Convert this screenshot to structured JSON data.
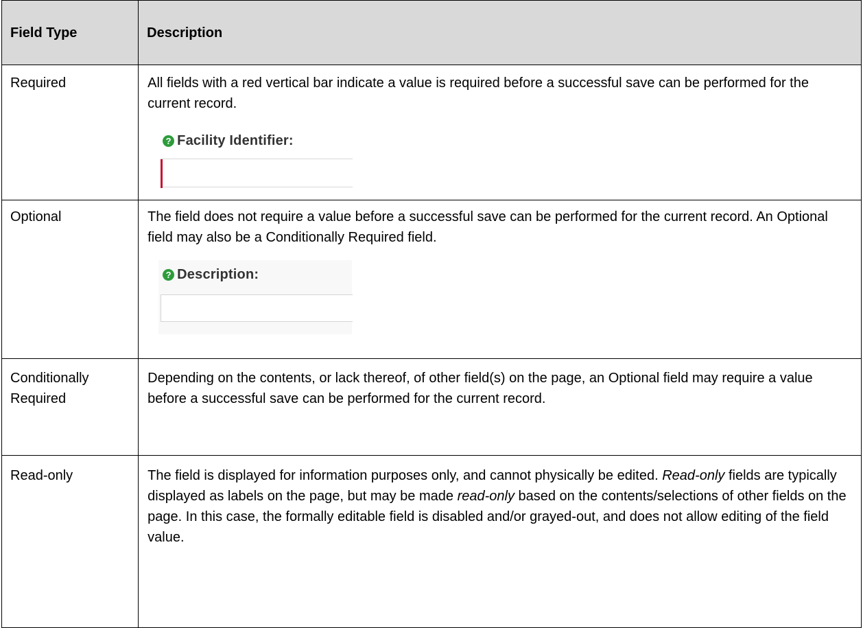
{
  "table": {
    "headers": {
      "field_type": "Field Type",
      "description": "Description"
    },
    "rows": [
      {
        "type": "Required",
        "description": "All fields with a red vertical bar indicate a value is required before a successful save can be performed for the current record.",
        "example_label": "Facility Identifier:"
      },
      {
        "type": "Optional",
        "description": "The field does not require a value before a successful save can be performed for the current record. An Optional field may also be a Conditionally Required field.",
        "example_label": "Description:"
      },
      {
        "type": "Conditionally Required",
        "description": "Depending on the contents, or lack thereof, of other field(s) on the page, an Optional field may require a value before a successful save can be performed for the current record."
      },
      {
        "type": "Read-only",
        "description_parts": {
          "p1": "The field is displayed for information purposes only, and cannot physically be edited. ",
          "p2_em": "Read-only",
          "p3": " fields are typically displayed as labels on the page, but may be made ",
          "p4_em": "read-only",
          "p5": " based on the contents/selections of other fields on the page. In this case, the formally editable field is disabled and/or grayed-out, and does not allow editing of the field value."
        }
      }
    ]
  },
  "icons": {
    "help": "question-mark-circle-icon",
    "help_glyph": "?"
  },
  "colors": {
    "header_bg": "#d9d9d9",
    "required_bar": "#c8102e",
    "help_icon": "#2e9c3b"
  }
}
